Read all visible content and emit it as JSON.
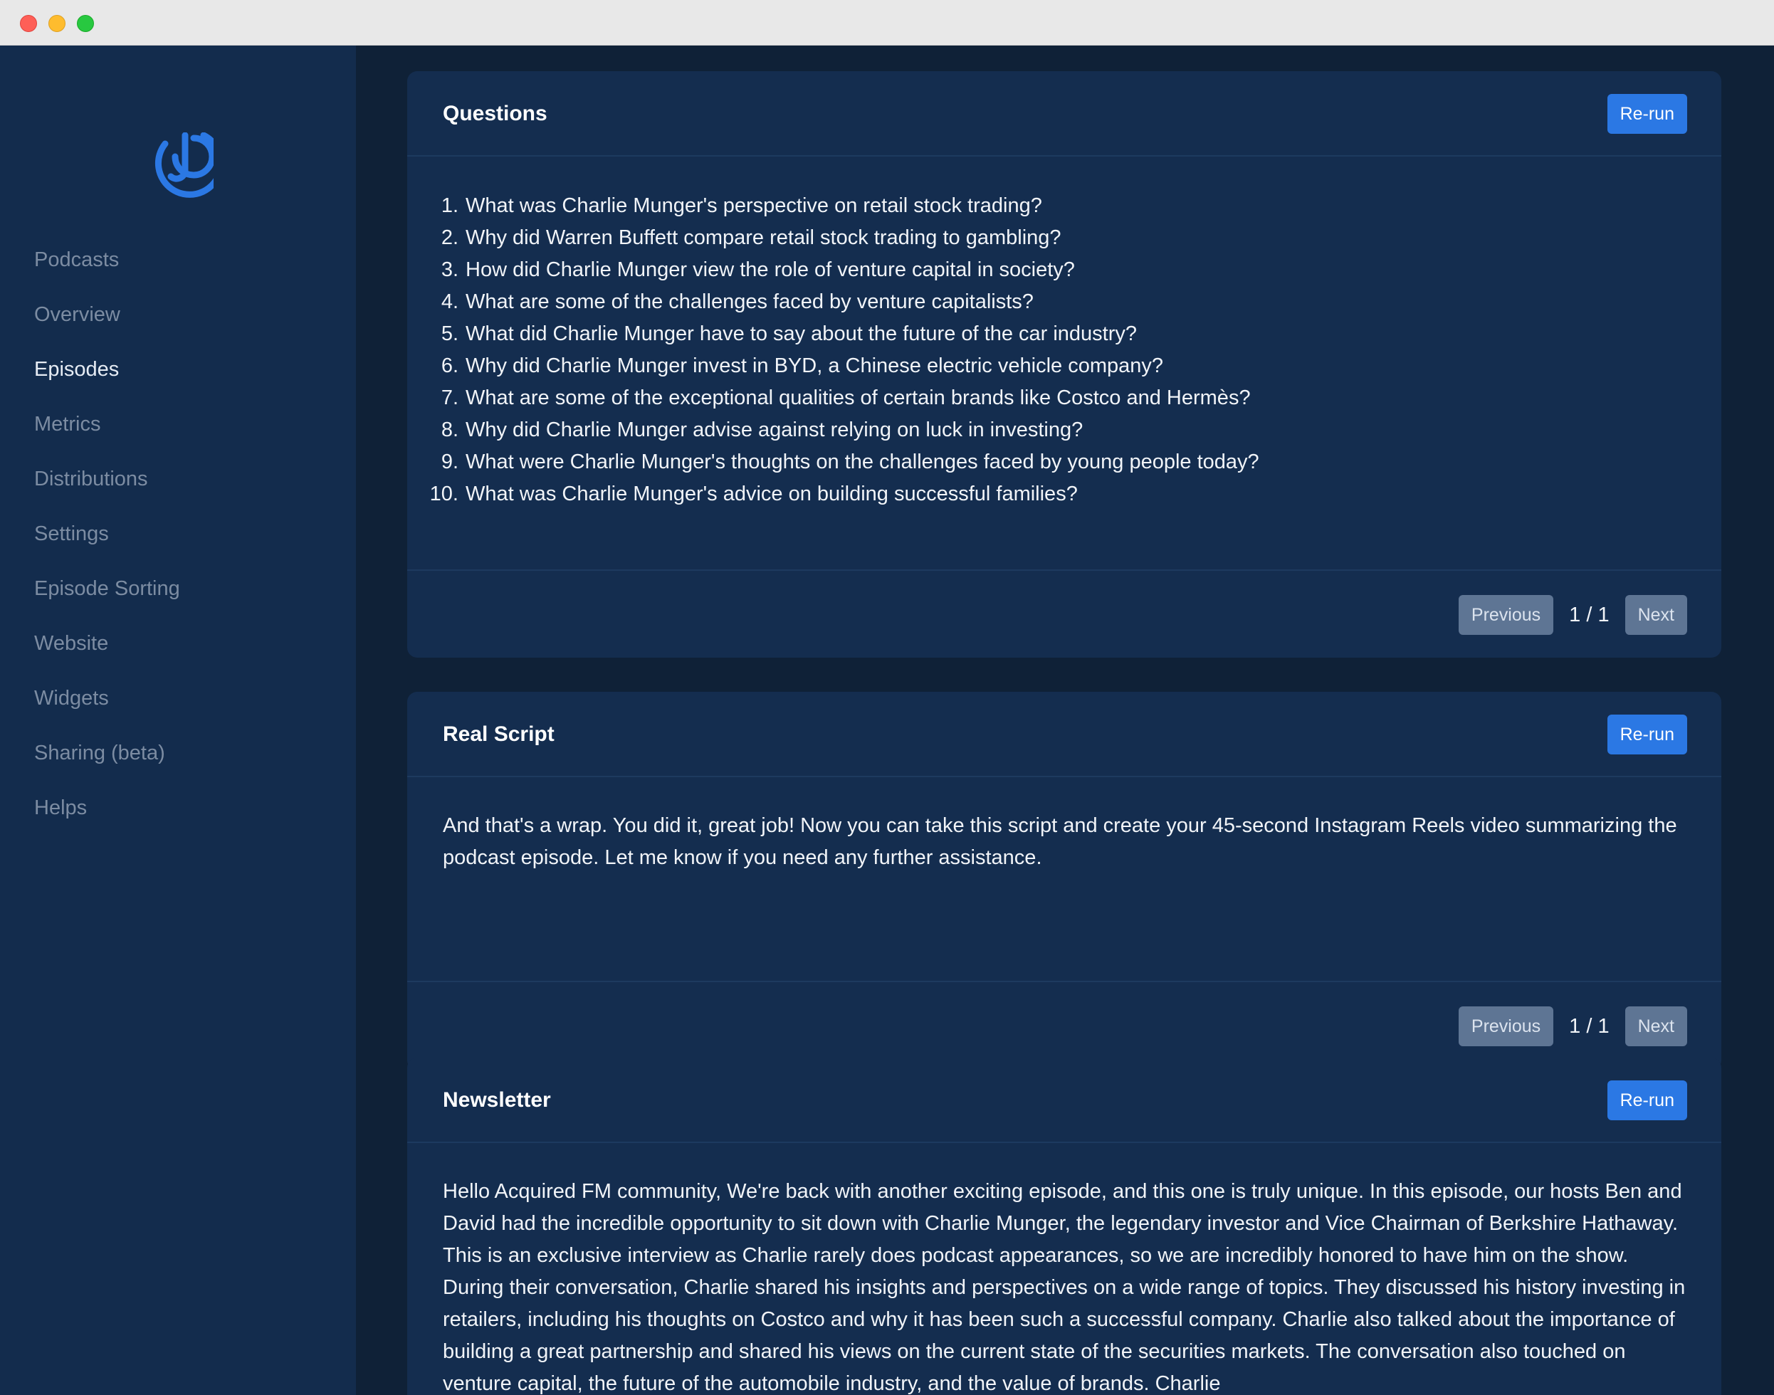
{
  "sidebar": {
    "items": [
      {
        "label": "Podcasts",
        "active": false
      },
      {
        "label": "Overview",
        "active": false
      },
      {
        "label": "Episodes",
        "active": true
      },
      {
        "label": "Metrics",
        "active": false
      },
      {
        "label": "Distributions",
        "active": false
      },
      {
        "label": "Settings",
        "active": false
      },
      {
        "label": "Episode Sorting",
        "active": false
      },
      {
        "label": "Website",
        "active": false
      },
      {
        "label": "Widgets",
        "active": false
      },
      {
        "label": "Sharing (beta)",
        "active": false
      },
      {
        "label": "Helps",
        "active": false
      }
    ]
  },
  "colors": {
    "accent": "#2b78e4",
    "sidebar_bg": "#132c4d",
    "card_bg": "#142d4f",
    "page_bg": "#0f2137"
  },
  "questions": {
    "title": "Questions",
    "rerun_label": "Re-run",
    "items": [
      {
        "num": "1.",
        "text": "What was Charlie Munger's perspective on retail stock trading?"
      },
      {
        "num": "2.",
        "text": "Why did Warren Buffett compare retail stock trading to gambling?"
      },
      {
        "num": "3.",
        "text": "How did Charlie Munger view the role of venture capital in society?"
      },
      {
        "num": "4.",
        "text": "What are some of the challenges faced by venture capitalists?"
      },
      {
        "num": "5.",
        "text": "What did Charlie Munger have to say about the future of the car industry?"
      },
      {
        "num": "6.",
        "text": "Why did Charlie Munger invest in BYD, a Chinese electric vehicle company?"
      },
      {
        "num": "7.",
        "text": "What are some of the exceptional qualities of certain brands like Costco and Hermès?"
      },
      {
        "num": "8.",
        "text": "Why did Charlie Munger advise against relying on luck in investing?"
      },
      {
        "num": "9.",
        "text": "What were Charlie Munger's thoughts on the challenges faced by young people today?"
      },
      {
        "num": "10.",
        "text": "What was Charlie Munger's advice on building successful families?"
      }
    ],
    "pager": {
      "previous": "Previous",
      "page": "1 / 1",
      "next": "Next"
    }
  },
  "real_script": {
    "title": "Real Script",
    "rerun_label": "Re-run",
    "body": "And that's a wrap. You did it, great job! Now you can take this script and create your 45-second Instagram Reels video summarizing the podcast episode. Let me know if you need any further assistance.",
    "pager": {
      "previous": "Previous",
      "page": "1 / 1",
      "next": "Next"
    }
  },
  "newsletter": {
    "title": "Newsletter",
    "rerun_label": "Re-run",
    "body": "Hello Acquired FM community, We're back with another exciting episode, and this one is truly unique. In this episode, our hosts Ben and David had the incredible opportunity to sit down with Charlie Munger, the legendary investor and Vice Chairman of Berkshire Hathaway. This is an exclusive interview as Charlie rarely does podcast appearances, so we are incredibly honored to have him on the show. During their conversation, Charlie shared his insights and perspectives on a wide range of topics. They discussed his history investing in retailers, including his thoughts on Costco and why it has been such a successful company. Charlie also talked about the importance of building a great partnership and shared his views on the current state of the securities markets. The conversation also touched on venture capital, the future of the automobile industry, and the value of brands. Charlie"
  }
}
